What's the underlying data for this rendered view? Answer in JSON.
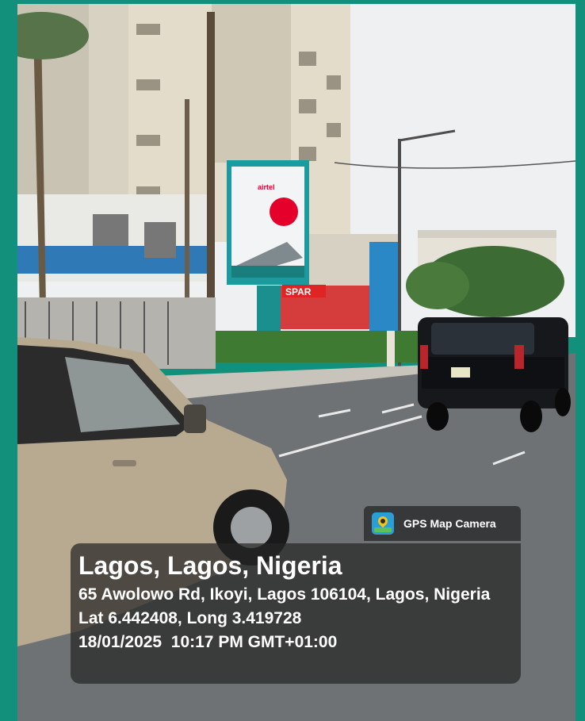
{
  "app": {
    "name": "GPS Map Camera"
  },
  "photo": {
    "description_icon": "street-photo"
  },
  "billboard": {
    "brand": "airtel"
  },
  "store_sign": {
    "text": "SPAR"
  },
  "location": {
    "title": "Lagos, Lagos, Nigeria",
    "address": "65 Awolowo Rd, Ikoyi, Lagos 106104, Lagos, Nigeria",
    "coordinates": "Lat 6.442408, Long 3.419728",
    "datetime": "18/01/2025  10:17 PM GMT+01:00"
  },
  "colors": {
    "frame": "#13907c",
    "overlay": "#262626",
    "text": "#ffffff",
    "brand_red": "#e4002b"
  }
}
